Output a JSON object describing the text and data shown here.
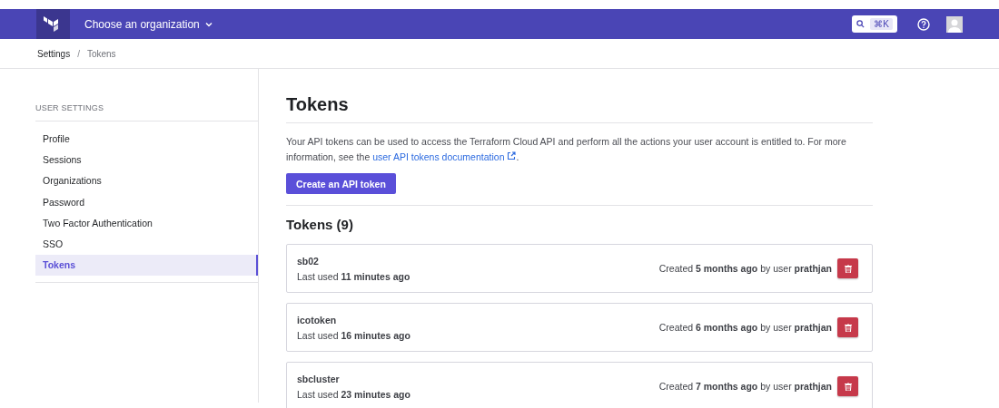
{
  "topbar": {
    "org_menu": "Choose an organization",
    "search_shortcut": "⌘K"
  },
  "breadcrumb": {
    "items": [
      "Settings",
      "Tokens"
    ],
    "separator": "/"
  },
  "sidebar": {
    "heading": "USER SETTINGS",
    "items": [
      {
        "label": "Profile",
        "selected": false
      },
      {
        "label": "Sessions",
        "selected": false
      },
      {
        "label": "Organizations",
        "selected": false
      },
      {
        "label": "Password",
        "selected": false
      },
      {
        "label": "Two Factor Authentication",
        "selected": false
      },
      {
        "label": "SSO",
        "selected": false
      },
      {
        "label": "Tokens",
        "selected": true
      }
    ]
  },
  "page": {
    "title": "Tokens",
    "description": "Your API tokens can be used to access the Terraform Cloud API and perform all the actions your user account is entitled to. For more information, see the ",
    "link": "user API tokens documentation",
    "description_end": ".",
    "create_button": "Create an API token",
    "list_title": "Tokens (9)"
  },
  "tokens": [
    {
      "name": "sb02",
      "last_used": "Last used **11 minutes ago**",
      "created": "Created **5 months ago** by user **prathjan**"
    },
    {
      "name": "icotoken",
      "last_used": "Last used **16 minutes ago**",
      "created": "Created **6 months ago** by user **prathjan**"
    },
    {
      "name": "sbcluster",
      "last_used": "Last used **23 minutes ago**",
      "created": "Created **7 months ago** by user **prathjan**"
    }
  ]
}
